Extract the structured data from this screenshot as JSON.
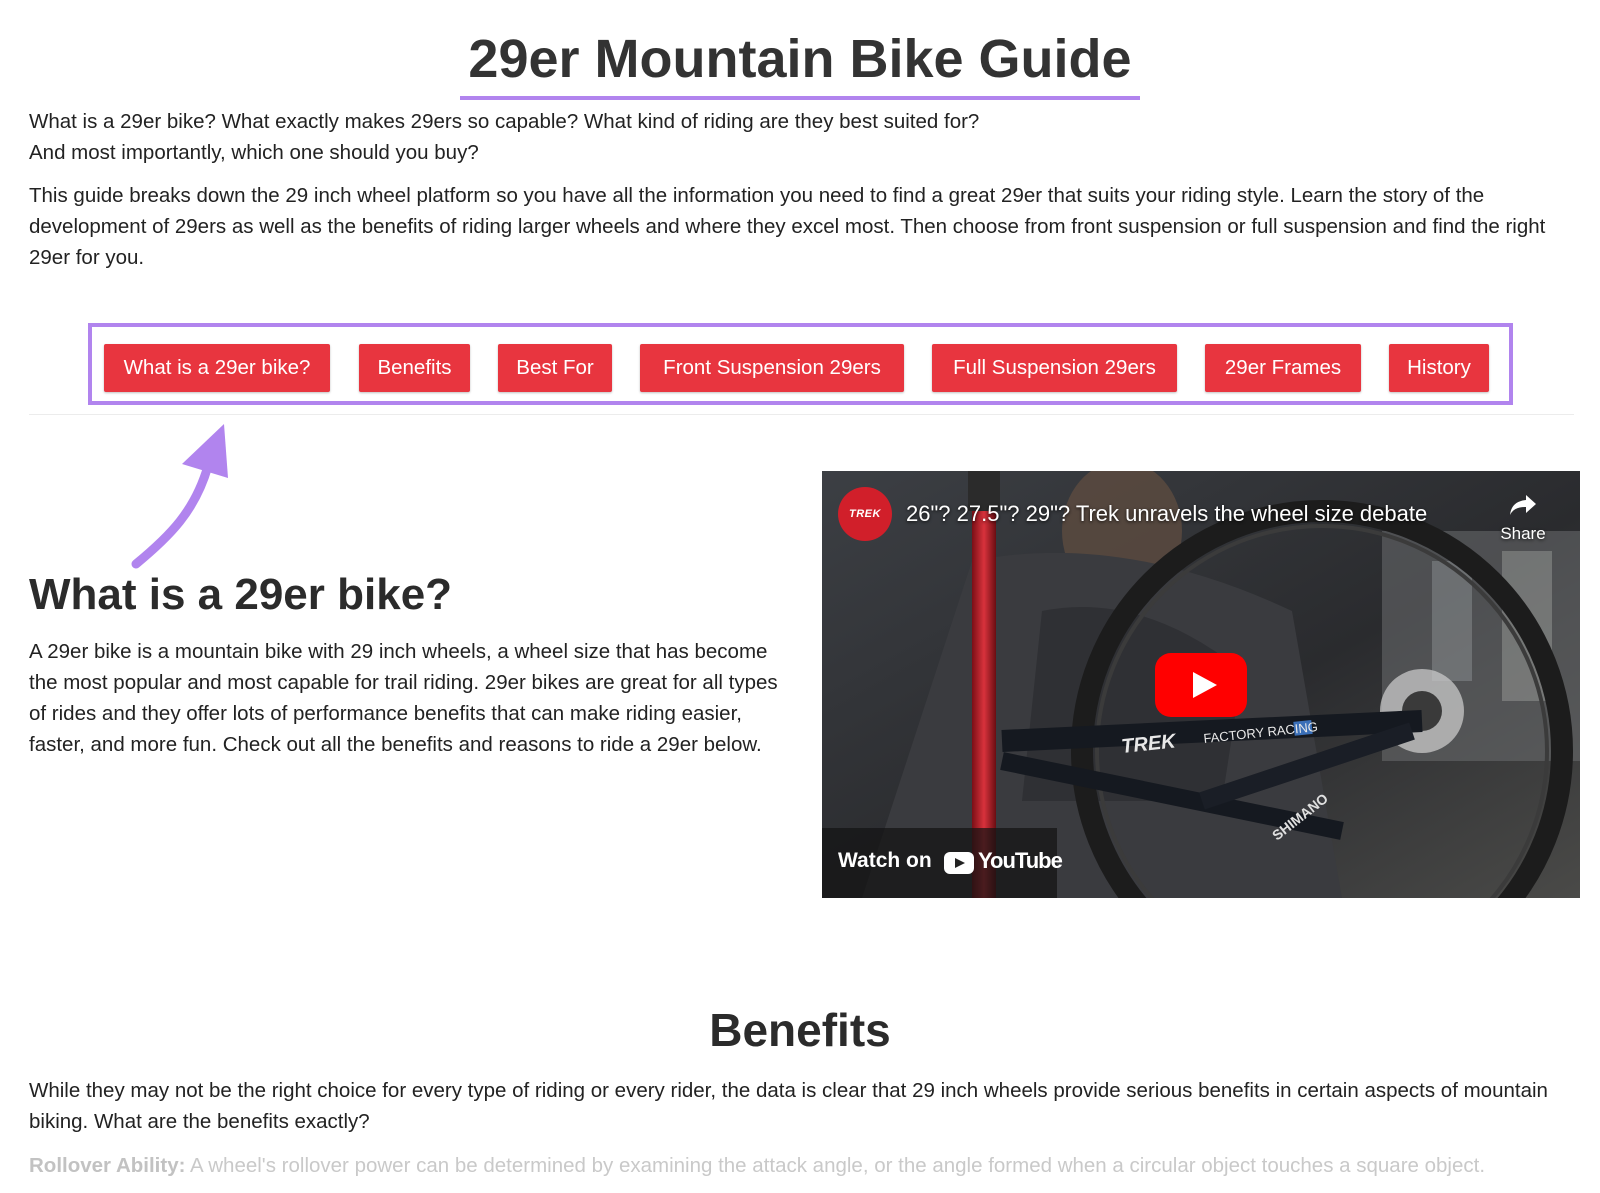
{
  "page": {
    "title": "29er Mountain Bike Guide",
    "intro_line1": "What is a 29er bike? What exactly makes 29ers so capable? What kind of riding are they best suited for?",
    "intro_line2": "And most importantly, which one should you buy?",
    "intro_paragraph": "This guide breaks down the 29 inch wheel platform so you have all the information you need to find a great 29er that suits your riding style. Learn the story of the development of 29ers as well as the benefits of riding larger wheels and where they excel most. Then choose from front suspension or full suspension and find the right 29er for you."
  },
  "nav": {
    "items": [
      "What is a 29er bike?",
      "Benefits",
      "Best For",
      "Front Suspension 29ers",
      "Full Suspension 29ers",
      "29er Frames",
      "History"
    ]
  },
  "colors": {
    "button": "#e8353f",
    "highlight": "#b184ee"
  },
  "section1": {
    "heading": "What is a 29er bike?",
    "text": "A 29er bike is a mountain bike with 29 inch wheels, a wheel size that has become the most popular and most capable for trail riding. 29er bikes are great for all types of rides and they offer lots of performance benefits that can make riding easier, faster, and more fun. Check out all the benefits and reasons to ride a 29er below."
  },
  "video": {
    "channel_logo": "TREK",
    "title": "26\"? 27.5\"? 29\"? Trek unravels the wheel size debate",
    "share_label": "Share",
    "watch_label": "Watch on",
    "youtube_label": "YouTube",
    "frame_text_brand": "TREK",
    "frame_text_team": "FACTORY RACING",
    "frame_text_shimano": "SHIMANO"
  },
  "benefits": {
    "heading": "Benefits",
    "text": "While they may not be the right choice for every type of riding or every rider, the data is clear that 29 inch wheels provide serious benefits in certain aspects of mountain biking. What are the benefits exactly?",
    "rollover_label": "Rollover Ability:",
    "rollover_text": " A wheel's rollover power can be determined by examining the attack angle, or the angle formed when a circular object touches a square object."
  }
}
